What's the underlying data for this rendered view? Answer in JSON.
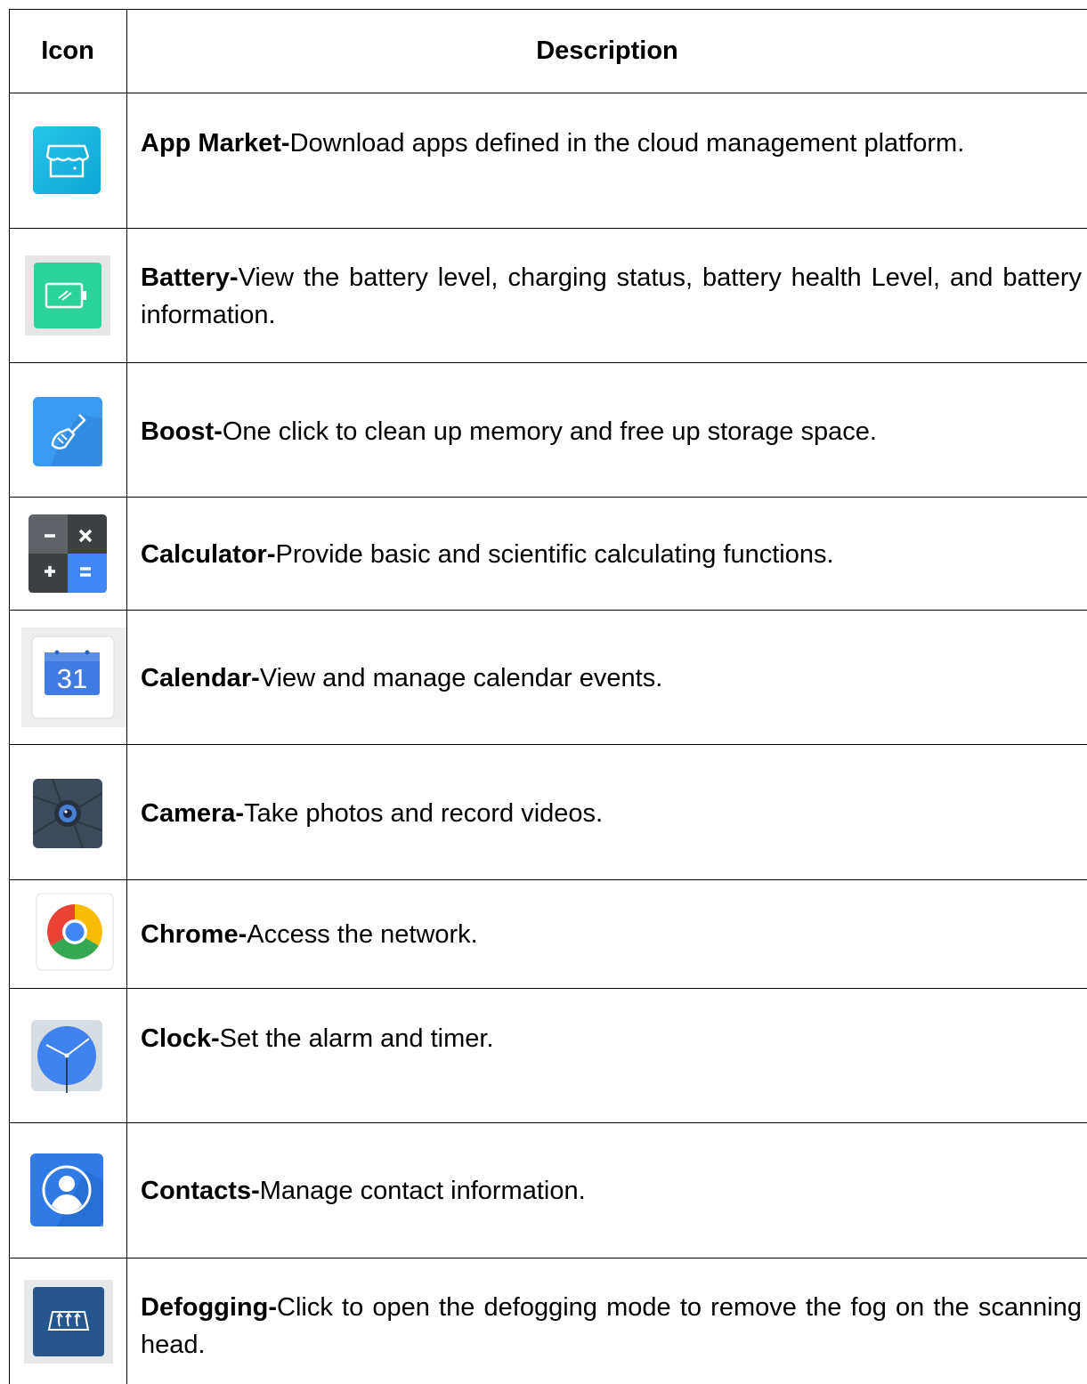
{
  "table": {
    "headers": {
      "icon": "Icon",
      "description": "Description"
    },
    "rows": [
      {
        "name": "App Market-",
        "text": "Download apps defined in the cloud management platform.",
        "icon": "store-icon"
      },
      {
        "name": "Battery-",
        "text": "View the battery level, charging status, battery health Level, and battery information.",
        "icon": "battery-icon"
      },
      {
        "name": "Boost-",
        "text": "One click to clean up memory and free up storage space.",
        "icon": "broom-icon"
      },
      {
        "name": "Calculator-",
        "text": "Provide basic and scientific calculating functions.",
        "icon": "calculator-icon"
      },
      {
        "name": "Calendar-",
        "text": "View and manage calendar events.",
        "icon": "calendar-icon",
        "icon_text": "31"
      },
      {
        "name": "Camera-",
        "text": "Take photos and record videos.",
        "icon": "camera-icon"
      },
      {
        "name": "Chrome-",
        "text": "Access the network.",
        "icon": "chrome-icon"
      },
      {
        "name": "Clock-",
        "text": "Set the alarm and timer.",
        "icon": "clock-icon"
      },
      {
        "name": "Contacts-",
        "text": "Manage contact information.",
        "icon": "contacts-icon"
      },
      {
        "name": "Defogging-",
        "text": "Click to open the defogging mode to remove the fog on the scanning head.",
        "icon": "defogging-icon"
      }
    ]
  }
}
